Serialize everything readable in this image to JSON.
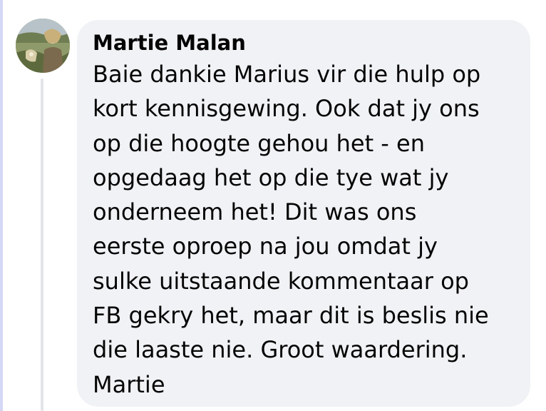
{
  "comment": {
    "author": "Martie Malan",
    "avatar_icon": "profile-photo",
    "text": "Baie dankie Marius vir die hulp op\nkort kennisgewing. Ook dat jy ons\nop die hoogte gehou het - en\nopgedaag het op die tye wat jy\nonderneem het! Dit was ons\neerste oproep na jou omdat jy\nsulke uitstaande kommentaar op\nFB gekry het, maar dit is beslis nie\ndie laaste nie. Groot waardering.\nMartie"
  },
  "colors": {
    "bubble_background": "#f0f2f5",
    "text": "#050505",
    "left_rule": "#d4d8f5",
    "thread_line": "#e2e4e8"
  }
}
